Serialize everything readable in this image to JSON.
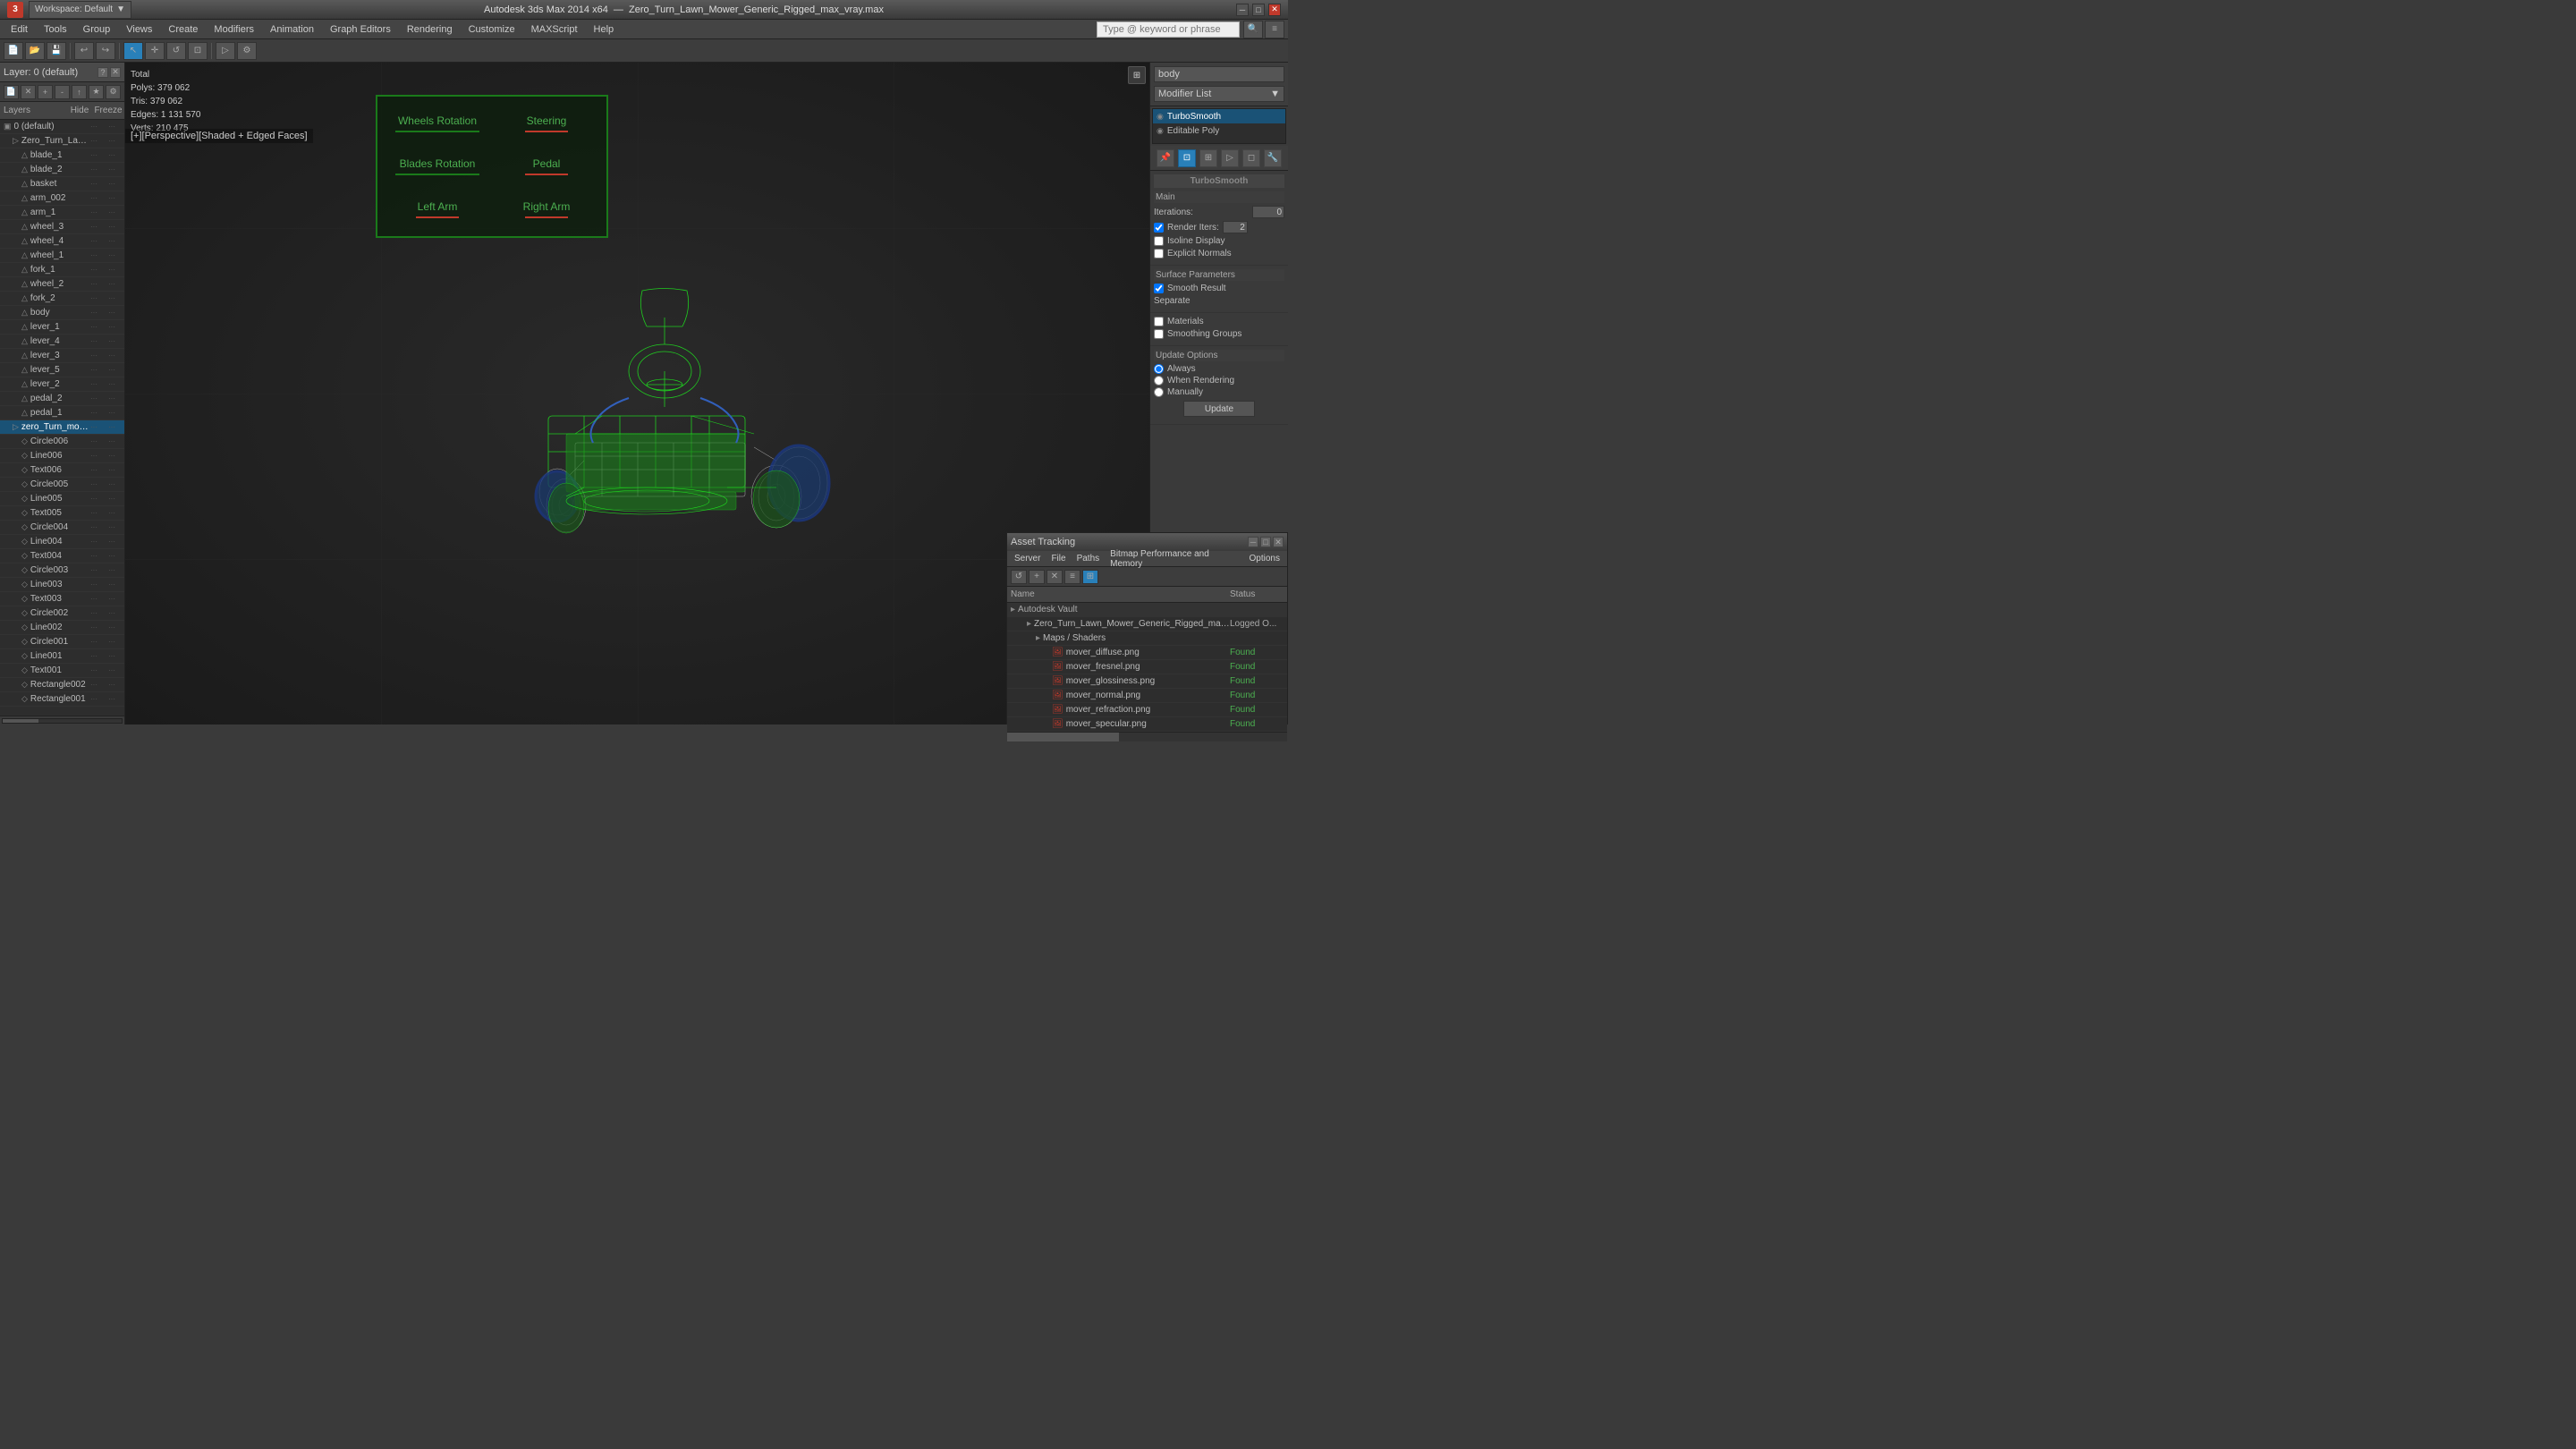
{
  "titlebar": {
    "app_name": "Autodesk 3ds Max 2014 x64",
    "file_name": "Zero_Turn_Lawn_Mower_Generic_Rigged_max_vray.max",
    "workspace_label": "Workspace: Default",
    "minimize_label": "─",
    "maximize_label": "□",
    "close_label": "✕",
    "logo": "3"
  },
  "menubar": {
    "items": [
      {
        "id": "edit",
        "label": "Edit"
      },
      {
        "id": "tools",
        "label": "Tools"
      },
      {
        "id": "group",
        "label": "Group"
      },
      {
        "id": "views",
        "label": "Views"
      },
      {
        "id": "create",
        "label": "Create"
      },
      {
        "id": "modifiers",
        "label": "Modifiers"
      },
      {
        "id": "animation",
        "label": "Animation"
      },
      {
        "id": "graph-editors",
        "label": "Graph Editors"
      },
      {
        "id": "rendering",
        "label": "Rendering"
      },
      {
        "id": "customize",
        "label": "Customize"
      },
      {
        "id": "maxscript",
        "label": "MAXScript"
      },
      {
        "id": "help",
        "label": "Help"
      }
    ]
  },
  "search": {
    "placeholder": "Type @ keyword or phrase"
  },
  "viewport": {
    "label": "[+][Perspective][Shaded + Edged Faces]",
    "stats": {
      "polys_label": "Polys:",
      "polys_value": "379 062",
      "tris_label": "Tris:",
      "tris_value": "379 062",
      "edges_label": "Edges: 1 131 570",
      "verts_label": "Verts:",
      "verts_value": "210 475",
      "total_label": "Total"
    }
  },
  "controller_ui": {
    "items": [
      {
        "label": "Wheels Rotation",
        "has_line": true,
        "line_color": "green"
      },
      {
        "label": "Steering",
        "has_line": true,
        "line_color": "red"
      },
      {
        "label": "Blades Rotation",
        "has_line": true,
        "line_color": "green"
      },
      {
        "label": "Pedal",
        "has_line": true,
        "line_color": "red"
      },
      {
        "label": "Left Arm",
        "has_line": true,
        "line_color": "red"
      },
      {
        "label": "Right Arm",
        "has_line": true,
        "line_color": "red"
      }
    ]
  },
  "layer_panel": {
    "title": "Layer: 0 (default)",
    "columns": {
      "layers": "Layers",
      "hide": "Hide",
      "freeze": "Freeze"
    },
    "items": [
      {
        "id": "default",
        "label": "0 (default)",
        "indent": 0,
        "type": "layer",
        "selected": false
      },
      {
        "id": "group1",
        "label": "Zero_Turn_Lawn_Mower_Generic_Rigged",
        "indent": 10,
        "type": "group",
        "selected": false
      },
      {
        "id": "blade1",
        "label": "blade_1",
        "indent": 20,
        "type": "mesh",
        "selected": false
      },
      {
        "id": "blade2",
        "label": "blade_2",
        "indent": 20,
        "type": "mesh",
        "selected": false
      },
      {
        "id": "basket",
        "label": "basket",
        "indent": 20,
        "type": "mesh",
        "selected": false
      },
      {
        "id": "arm002",
        "label": "arm_002",
        "indent": 20,
        "type": "mesh",
        "selected": false
      },
      {
        "id": "arm1",
        "label": "arm_1",
        "indent": 20,
        "type": "mesh",
        "selected": false
      },
      {
        "id": "wheel3",
        "label": "wheel_3",
        "indent": 20,
        "type": "mesh",
        "selected": false
      },
      {
        "id": "wheel4",
        "label": "wheel_4",
        "indent": 20,
        "type": "mesh",
        "selected": false
      },
      {
        "id": "wheel1",
        "label": "wheel_1",
        "indent": 20,
        "type": "mesh",
        "selected": false
      },
      {
        "id": "fork1",
        "label": "fork_1",
        "indent": 20,
        "type": "mesh",
        "selected": false
      },
      {
        "id": "wheel2",
        "label": "wheel_2",
        "indent": 20,
        "type": "mesh",
        "selected": false
      },
      {
        "id": "fork2",
        "label": "fork_2",
        "indent": 20,
        "type": "mesh",
        "selected": false
      },
      {
        "id": "body",
        "label": "body",
        "indent": 20,
        "type": "mesh",
        "selected": false
      },
      {
        "id": "lever1",
        "label": "lever_1",
        "indent": 20,
        "type": "mesh",
        "selected": false
      },
      {
        "id": "lever4",
        "label": "lever_4",
        "indent": 20,
        "type": "mesh",
        "selected": false
      },
      {
        "id": "lever3",
        "label": "lever_3",
        "indent": 20,
        "type": "mesh",
        "selected": false
      },
      {
        "id": "lever5",
        "label": "lever_5",
        "indent": 20,
        "type": "mesh",
        "selected": false
      },
      {
        "id": "lever2",
        "label": "lever_2",
        "indent": 20,
        "type": "mesh",
        "selected": false
      },
      {
        "id": "pedal2",
        "label": "pedal_2",
        "indent": 20,
        "type": "mesh",
        "selected": false
      },
      {
        "id": "pedal1",
        "label": "pedal_1",
        "indent": 20,
        "type": "mesh",
        "selected": false
      },
      {
        "id": "controllers",
        "label": "zero_Turn_mower_controllers",
        "indent": 10,
        "type": "group",
        "selected": true
      },
      {
        "id": "circle006",
        "label": "Circle006",
        "indent": 20,
        "type": "shape",
        "selected": false
      },
      {
        "id": "line006",
        "label": "Line006",
        "indent": 20,
        "type": "shape",
        "selected": false
      },
      {
        "id": "text006",
        "label": "Text006",
        "indent": 20,
        "type": "shape",
        "selected": false
      },
      {
        "id": "circle005",
        "label": "Circle005",
        "indent": 20,
        "type": "shape",
        "selected": false
      },
      {
        "id": "line005",
        "label": "Line005",
        "indent": 20,
        "type": "shape",
        "selected": false
      },
      {
        "id": "text005",
        "label": "Text005",
        "indent": 20,
        "type": "shape",
        "selected": false
      },
      {
        "id": "circle004",
        "label": "Circle004",
        "indent": 20,
        "type": "shape",
        "selected": false
      },
      {
        "id": "line004",
        "label": "Line004",
        "indent": 20,
        "type": "shape",
        "selected": false
      },
      {
        "id": "text004",
        "label": "Text004",
        "indent": 20,
        "type": "shape",
        "selected": false
      },
      {
        "id": "circle003",
        "label": "Circle003",
        "indent": 20,
        "type": "shape",
        "selected": false
      },
      {
        "id": "line003",
        "label": "Line003",
        "indent": 20,
        "type": "shape",
        "selected": false
      },
      {
        "id": "text003",
        "label": "Text003",
        "indent": 20,
        "type": "shape",
        "selected": false
      },
      {
        "id": "circle002",
        "label": "Circle002",
        "indent": 20,
        "type": "shape",
        "selected": false
      },
      {
        "id": "line002",
        "label": "Line002",
        "indent": 20,
        "type": "shape",
        "selected": false
      },
      {
        "id": "circle001",
        "label": "Circle001",
        "indent": 20,
        "type": "shape",
        "selected": false
      },
      {
        "id": "line001",
        "label": "Line001",
        "indent": 20,
        "type": "shape",
        "selected": false
      },
      {
        "id": "text001",
        "label": "Text001",
        "indent": 20,
        "type": "shape",
        "selected": false
      },
      {
        "id": "rect002",
        "label": "Rectangle002",
        "indent": 20,
        "type": "shape",
        "selected": false
      },
      {
        "id": "rect001",
        "label": "Rectangle001",
        "indent": 20,
        "type": "shape",
        "selected": false
      }
    ]
  },
  "right_panel": {
    "body_label": "body",
    "modifier_list_label": "Modifier List",
    "modifier_dropdown_arrow": "▼",
    "modifiers": [
      {
        "id": "turbosmooth",
        "label": "TurboSmooth",
        "active": true,
        "icon": "◉"
      },
      {
        "id": "editpoly",
        "label": "Editable Poly",
        "active": false,
        "icon": "◉"
      }
    ],
    "icons": [
      "⊞",
      "■",
      "▣",
      "⊡",
      "≡"
    ],
    "turbosmooth": {
      "title": "TurboSmooth",
      "main_label": "Main",
      "iterations_label": "Iterations:",
      "iterations_value": "0",
      "render_iters_label": "Render Iters:",
      "render_iters_value": "2",
      "render_iters_checked": true,
      "isoline_label": "Isoline Display",
      "explicit_normals_label": "Explicit Normals"
    },
    "surface_params": {
      "title": "Surface Parameters",
      "smooth_result_label": "Smooth Result",
      "smooth_result_checked": true,
      "separate_label": "Separate",
      "materials_label": "Materials",
      "smoothing_groups_label": "Smoothing Groups"
    },
    "update_options": {
      "title": "Update Options",
      "always_label": "Always",
      "when_rendering_label": "When Rendering",
      "manually_label": "Manually",
      "update_btn_label": "Update"
    }
  },
  "asset_tracking": {
    "title": "Asset Tracking",
    "menu_items": [
      "Server",
      "File",
      "Paths",
      "Bitmap Performance and Memory",
      "Options"
    ],
    "columns": {
      "name": "Name",
      "status": "Status"
    },
    "rows": [
      {
        "id": "vault",
        "label": "Autodesk Vault",
        "indent": 0,
        "type": "root",
        "status": "",
        "icon": "▸"
      },
      {
        "id": "main-file",
        "label": "Zero_Turn_Lawn_Mower_Generic_Rigged_max_vray.max",
        "indent": 1,
        "type": "file",
        "status": "Logged O...",
        "icon": "▸"
      },
      {
        "id": "maps",
        "label": "Maps / Shaders",
        "indent": 2,
        "type": "folder",
        "status": "",
        "icon": "▸"
      },
      {
        "id": "diffuse",
        "label": "mover_diffuse.png",
        "indent": 3,
        "type": "image",
        "status": "Found",
        "icon": "🖼"
      },
      {
        "id": "fresnel",
        "label": "mover_fresnel.png",
        "indent": 3,
        "type": "image",
        "status": "Found",
        "icon": "🖼"
      },
      {
        "id": "glossiness",
        "label": "mover_glossiness.png",
        "indent": 3,
        "type": "image",
        "status": "Found",
        "icon": "🖼"
      },
      {
        "id": "normal",
        "label": "mover_normal.png",
        "indent": 3,
        "type": "image",
        "status": "Found",
        "icon": "🖼"
      },
      {
        "id": "refraction",
        "label": "mover_refraction.png",
        "indent": 3,
        "type": "image",
        "status": "Found",
        "icon": "🖼"
      },
      {
        "id": "specular",
        "label": "mover_specular.png",
        "indent": 3,
        "type": "image",
        "status": "Found",
        "icon": "🖼"
      }
    ]
  }
}
